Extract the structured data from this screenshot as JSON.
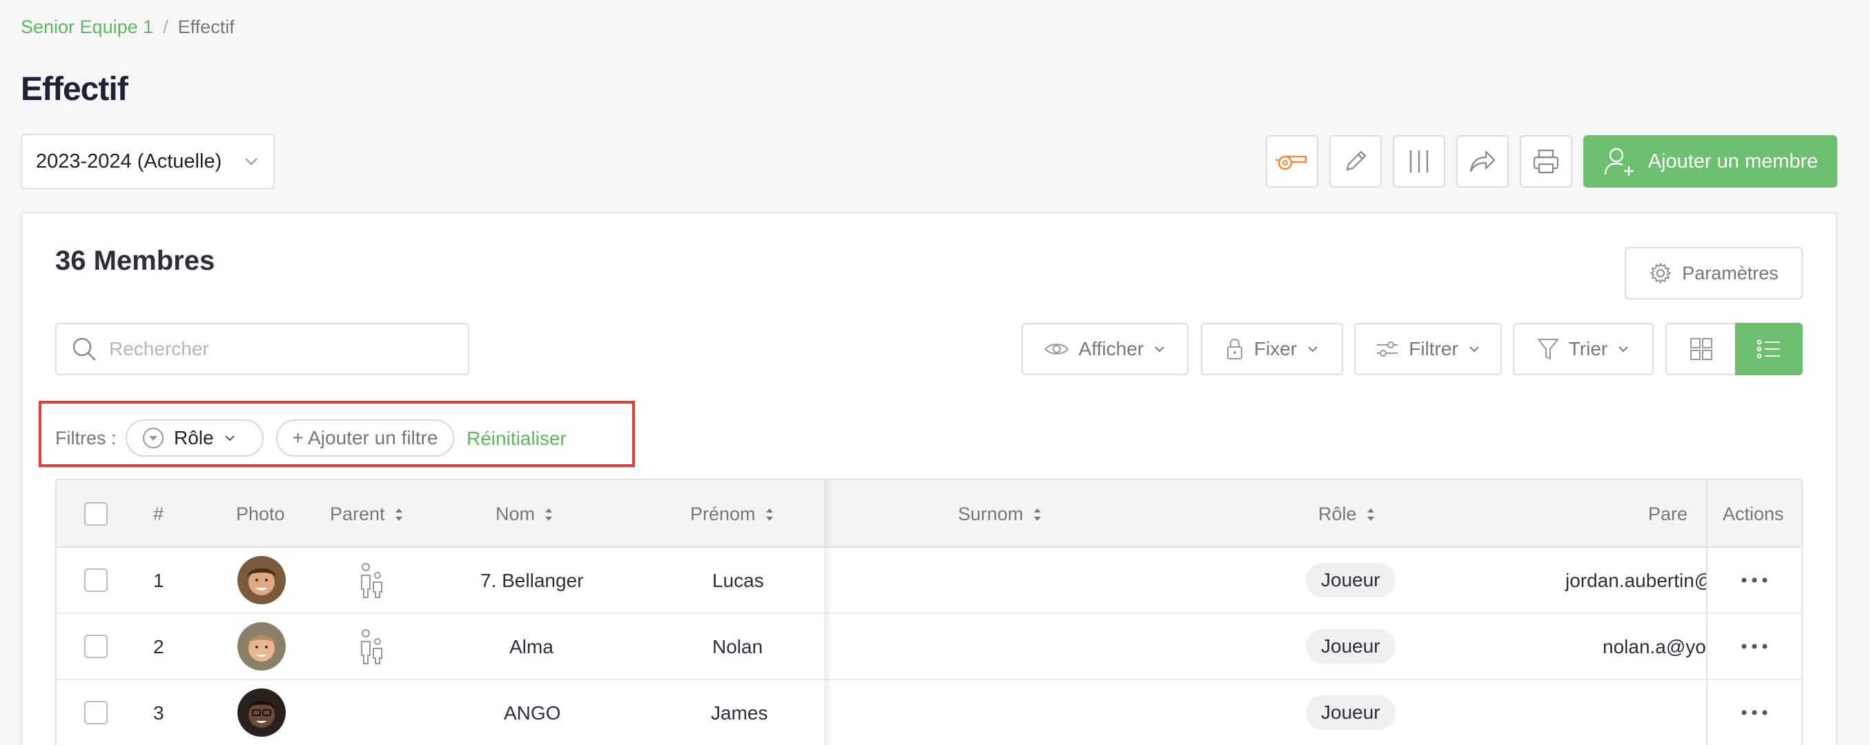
{
  "breadcrumb": {
    "parent": "Senior Equipe 1",
    "separator": "/",
    "current": "Effectif"
  },
  "page": {
    "title": "Effectif"
  },
  "season": {
    "selected": "2023-2024 (Actuelle)"
  },
  "toolbar": {
    "add_member_label": "Ajouter un membre",
    "accent_color": "#6cc070",
    "whistle_color": "#f08a3c"
  },
  "card": {
    "members_count_label": "36 Membres",
    "params_label": "Paramètres",
    "search_placeholder": "Rechercher",
    "afficher_label": "Afficher",
    "fixer_label": "Fixer",
    "filtrer_label": "Filtrer",
    "trier_label": "Trier"
  },
  "filters": {
    "label": "Filtres :",
    "role_chip": "Rôle",
    "add_filter": "+ Ajouter un filtre",
    "reset": "Réinitialiser"
  },
  "table": {
    "headers": {
      "num": "#",
      "photo": "Photo",
      "parent": "Parent",
      "nom": "Nom",
      "prenom": "Prénom",
      "surnom": "Surnom",
      "role": "Rôle",
      "pare": "Pare",
      "actions": "Actions"
    },
    "rows": [
      {
        "num": "1",
        "nom": "7. Bellanger",
        "prenom": "Lucas",
        "role": "Joueur",
        "parent_email": "jordan.aubertin@"
      },
      {
        "num": "2",
        "nom": "Alma",
        "prenom": "Nolan",
        "role": "Joueur",
        "parent_email": "nolan.a@yo"
      },
      {
        "num": "3",
        "nom": "ANGO",
        "prenom": "James",
        "role": "Joueur",
        "parent_email": ""
      }
    ]
  }
}
